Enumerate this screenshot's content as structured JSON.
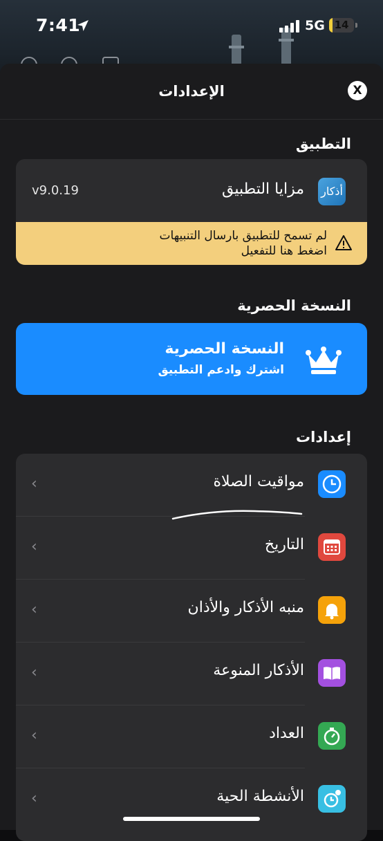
{
  "status_bar": {
    "time": "7:41",
    "network": "5G",
    "battery": "14",
    "battery_level": 0.14
  },
  "header": {
    "title": "الإعدادات",
    "close_label": "X"
  },
  "sections": {
    "app": "التطبيق",
    "exclusive": "النسخة الحصرية",
    "settings": "إعدادات"
  },
  "app_card": {
    "logo_text": "أذكار",
    "title": "مزايا التطبيق",
    "version": "v9.0.19",
    "warning_line1": "لم تسمح للتطبيق بارسال التنبيهات",
    "warning_line2": "اضغط هنا للتفعيل"
  },
  "promo": {
    "title": "النسخة الحصرية",
    "subtitle": "اشترك وادعم التطبيق"
  },
  "settings_items": [
    {
      "label": "مواقيت الصلاة",
      "icon": "clock-icon",
      "color": "#1a8cff"
    },
    {
      "label": "التاريخ",
      "icon": "calendar-icon",
      "color": "#e0483e"
    },
    {
      "label": "منبه الأذكار والأذان",
      "icon": "bell-icon",
      "color": "#f5a20a"
    },
    {
      "label": "الأذكار المنوعة",
      "icon": "book-icon",
      "color": "#a350e0"
    },
    {
      "label": "العداد",
      "icon": "stopwatch-icon",
      "color": "#34a853"
    },
    {
      "label": "الأنشطة الحية",
      "icon": "live-activity-icon",
      "color": "#38bfe3"
    }
  ]
}
